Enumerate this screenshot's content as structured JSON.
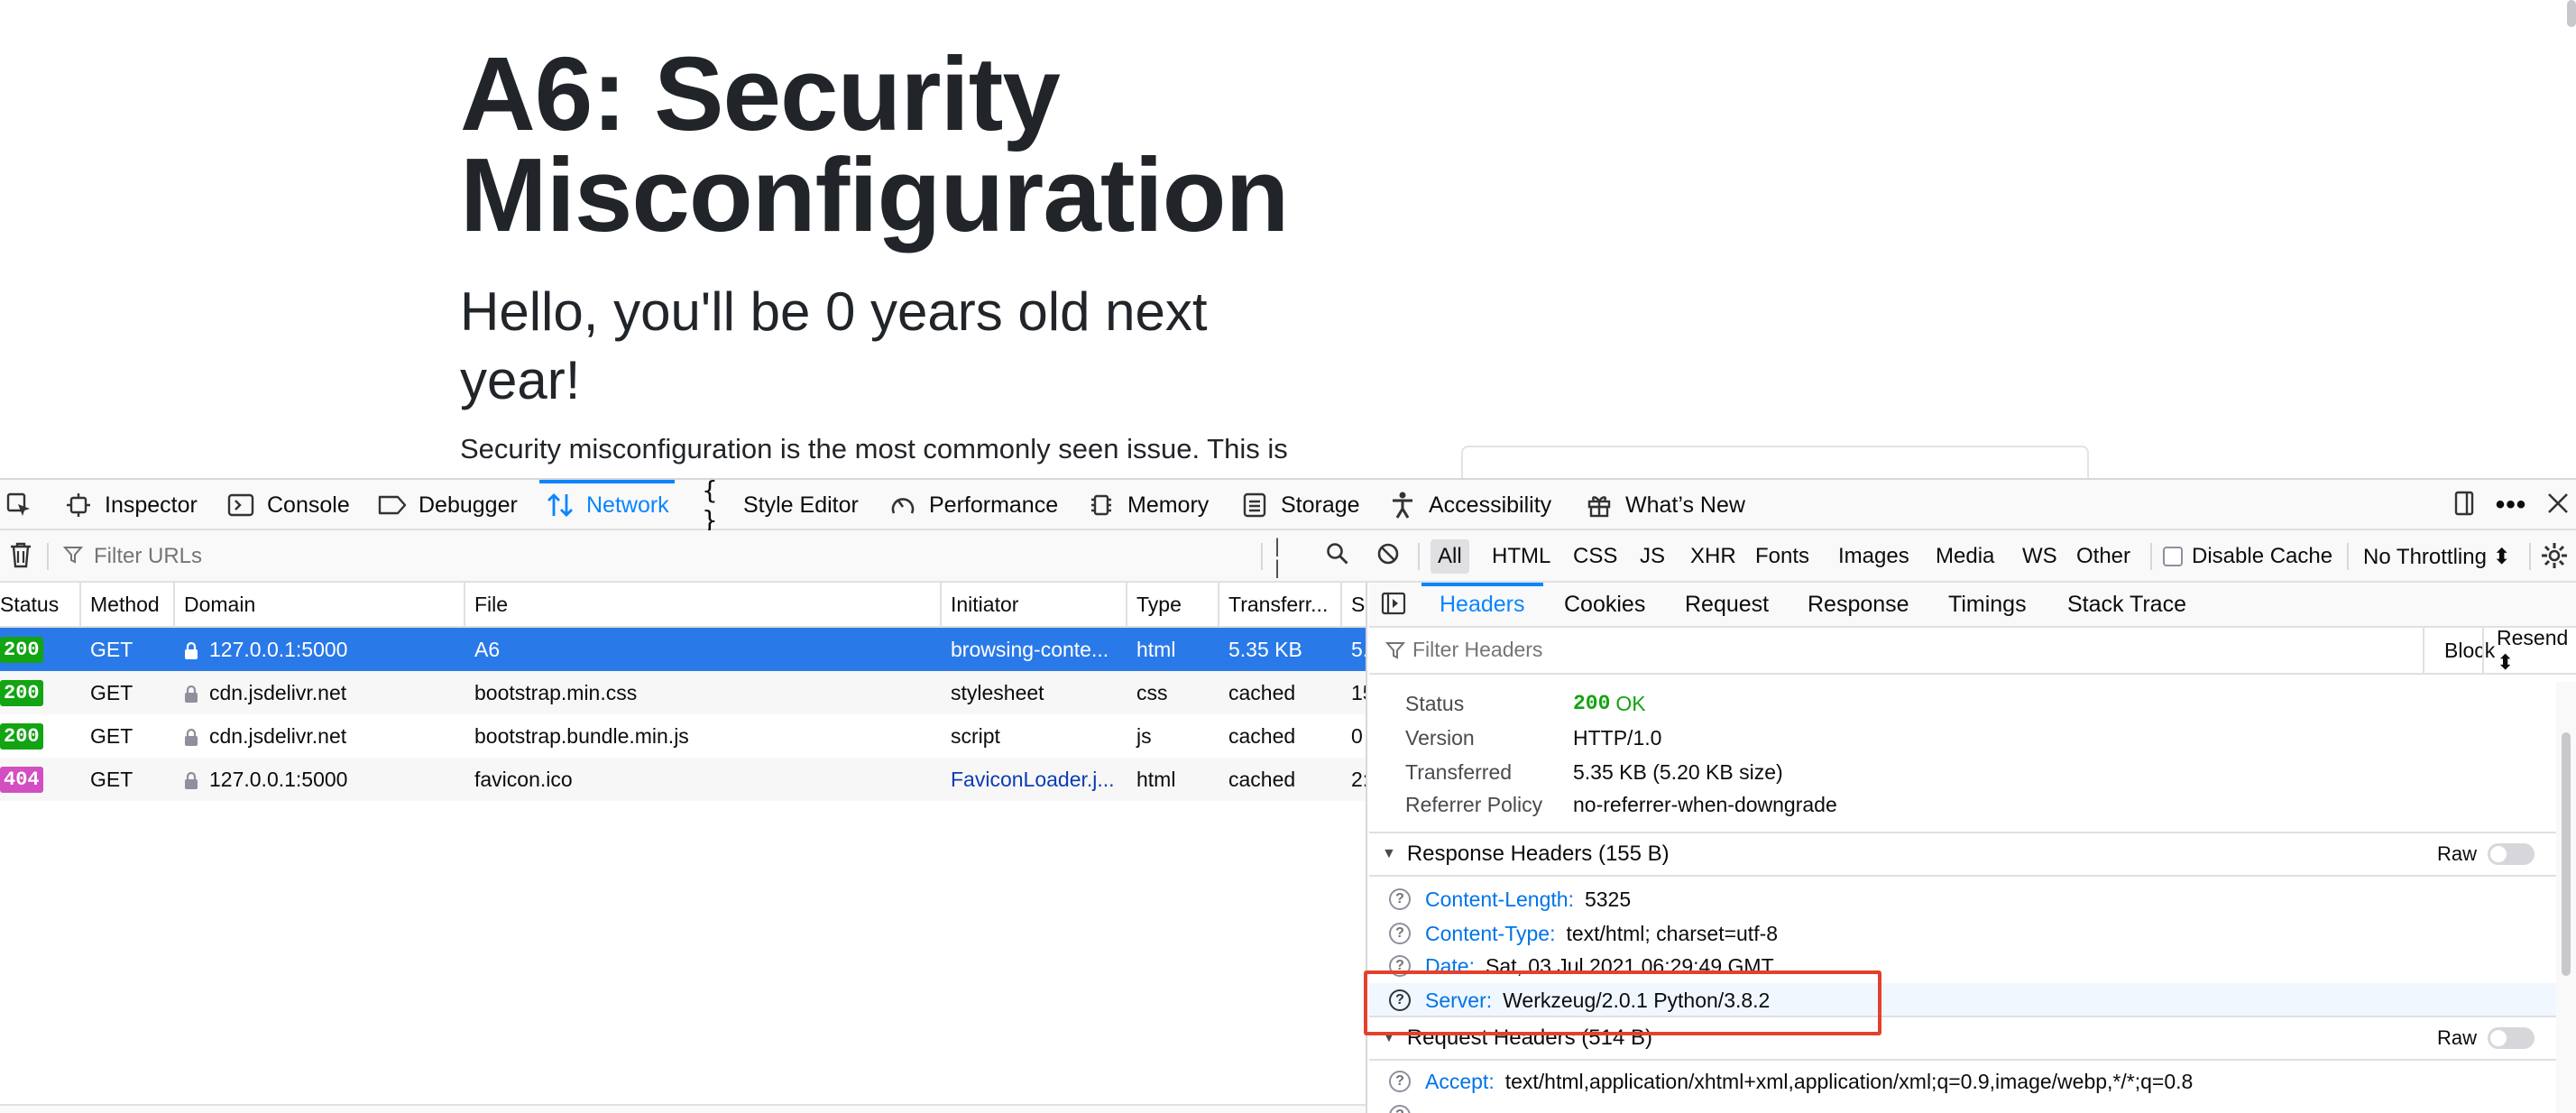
{
  "page": {
    "title": "A6: Security Misconfiguration",
    "subtitle": "Hello, you'll be 0 years old next year!",
    "paragraph": "Security misconfiguration is the most commonly seen issue. This is"
  },
  "toolbox": {
    "tabs": [
      {
        "label": "Inspector",
        "icon": "inspector-icon"
      },
      {
        "label": "Console",
        "icon": "console-icon"
      },
      {
        "label": "Debugger",
        "icon": "debugger-icon"
      },
      {
        "label": "Network",
        "icon": "network-icon",
        "selected": true
      },
      {
        "label": "Style Editor",
        "icon": "style-editor-icon"
      },
      {
        "label": "Performance",
        "icon": "performance-icon"
      },
      {
        "label": "Memory",
        "icon": "memory-icon"
      },
      {
        "label": "Storage",
        "icon": "storage-icon"
      },
      {
        "label": "Accessibility",
        "icon": "accessibility-icon"
      },
      {
        "label": "What’s New",
        "icon": "gift-icon"
      }
    ]
  },
  "net_toolbar": {
    "filter_placeholder": "Filter URLs",
    "pause_label": "| |",
    "type_filters": [
      "All",
      "HTML",
      "CSS",
      "JS",
      "XHR",
      "Fonts",
      "Images",
      "Media",
      "WS",
      "Other"
    ],
    "active_filter": "All",
    "disable_cache_label": "Disable Cache",
    "throttling_label": "No Throttling ⬍"
  },
  "request_table": {
    "columns": [
      "Status",
      "Method",
      "Domain",
      "File",
      "Initiator",
      "Type",
      "Transferr...",
      "S"
    ],
    "rows": [
      {
        "status": "200",
        "status_color": "#12a412",
        "method": "GET",
        "domain": "127.0.0.1:5000",
        "file": "A6",
        "initiator": "browsing-conte...",
        "type": "html",
        "transferred": "5.35 KB",
        "size": "5."
      },
      {
        "status": "200",
        "status_color": "#12a412",
        "method": "GET",
        "domain": "cdn.jsdelivr.net",
        "file": "bootstrap.min.css",
        "initiator": "stylesheet",
        "type": "css",
        "transferred": "cached",
        "size": "15"
      },
      {
        "status": "200",
        "status_color": "#12a412",
        "method": "GET",
        "domain": "cdn.jsdelivr.net",
        "file": "bootstrap.bundle.min.js",
        "initiator": "script",
        "type": "js",
        "transferred": "cached",
        "size": "0"
      },
      {
        "status": "404",
        "status_color": "#d24ec2",
        "method": "GET",
        "domain": "127.0.0.1:5000",
        "file": "favicon.ico",
        "initiator": "FaviconLoader.j...",
        "type": "html",
        "transferred": "cached",
        "size": "2:"
      }
    ]
  },
  "detail": {
    "tabs": [
      "Headers",
      "Cookies",
      "Request",
      "Response",
      "Timings",
      "Stack Trace"
    ],
    "selected_tab": "Headers",
    "filter_placeholder": "Filter Headers",
    "block_label": "Block",
    "resend_label": "Resend ⬍",
    "summary": {
      "status_label": "Status",
      "status_code": "200",
      "status_text": "OK",
      "version_label": "Version",
      "version_value": "HTTP/1.0",
      "transferred_label": "Transferred",
      "transferred_value": "5.35 KB (5.20 KB size)",
      "referrer_label": "Referrer Policy",
      "referrer_value": "no-referrer-when-downgrade"
    },
    "response_headers": {
      "title": "Response Headers (155 B)",
      "raw_label": "Raw",
      "items": [
        {
          "name": "Content-Length:",
          "value": "5325"
        },
        {
          "name": "Content-Type:",
          "value": "text/html; charset=utf-8"
        },
        {
          "name": "Date:",
          "value": "Sat, 03 Jul 2021 06:29:49 GMT"
        },
        {
          "name": "Server:",
          "value": "Werkzeug/2.0.1 Python/3.8.2"
        }
      ]
    },
    "request_headers": {
      "title": "Request Headers (514 B)",
      "raw_label": "Raw",
      "items": [
        {
          "name": "Accept:",
          "value": "text/html,application/xhtml+xml,application/xml;q=0.9,image/webp,*/*;q=0.8"
        }
      ]
    }
  },
  "colors": {
    "accent": "#0a84ff",
    "selected_row": "#2a79e8",
    "highlight_box": "#e4412c"
  }
}
